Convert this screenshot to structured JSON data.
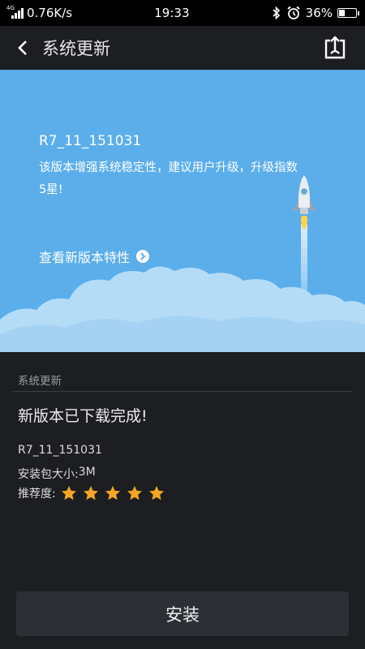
{
  "status_bar": {
    "network_type": "4G",
    "speed": "0.76K/s",
    "time": "19:33",
    "battery_percent": "36%",
    "battery_level": 0.36,
    "icons": [
      "signal-icon",
      "bluetooth-icon",
      "alarm-icon",
      "battery-icon"
    ]
  },
  "title_bar": {
    "title": "系统更新",
    "back_icon": "chevron-left-icon",
    "share_icon": "share-icon"
  },
  "banner": {
    "version": "R7_11_151031",
    "description": "该版本增强系统稳定性，建议用户升级，升级指数5星!",
    "features_link": "查看新版本特性",
    "colors": {
      "sky": "#5baeea",
      "cloud": "#b5dcf7"
    }
  },
  "details": {
    "section_header": "系统更新",
    "status": "新版本已下载完成!",
    "version": "R7_11_151031",
    "size_label": "安装包大小:",
    "size_value": "3M",
    "rating_label": "推荐度:",
    "rating": 5,
    "rating_max": 5,
    "star_color": "#f5a623"
  },
  "install_button": {
    "label": "安装"
  }
}
